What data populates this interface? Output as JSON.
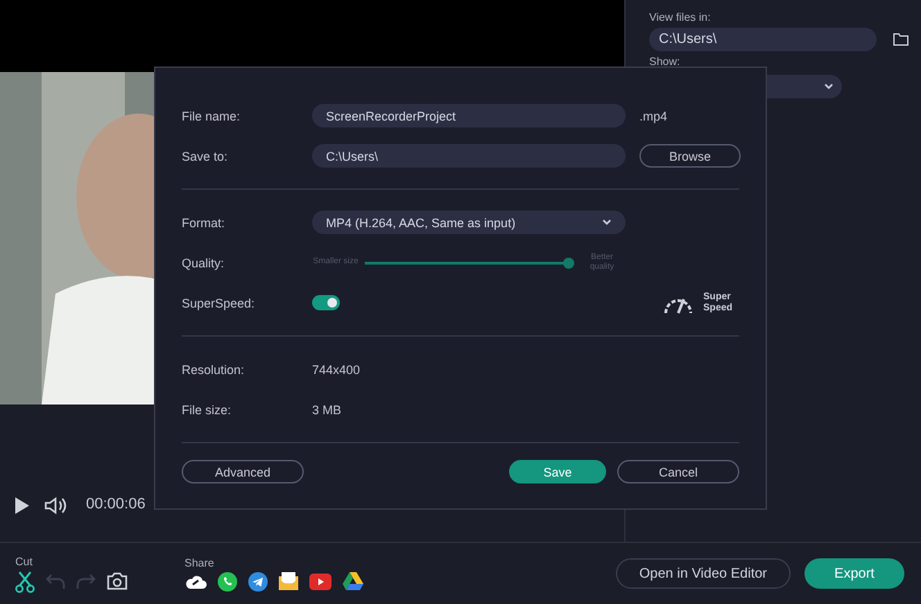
{
  "player": {
    "time": "00:00:06"
  },
  "right_panel": {
    "view_files_label": "View files in:",
    "view_files_path": "C:\\Users\\",
    "show_label": "Show:"
  },
  "dialog": {
    "file_name_label": "File name:",
    "file_name": "ScreenRecorderProject",
    "extension": ".mp4",
    "save_to_label": "Save to:",
    "save_to": "C:\\Users\\",
    "browse": "Browse",
    "format_label": "Format:",
    "format": "MP4 (H.264, AAC, Same as input)",
    "quality_label": "Quality:",
    "quality_min": "Smaller size",
    "quality_max": "Better quality",
    "quality": {
      "level": 0.98
    },
    "superspeed_label": "SuperSpeed:",
    "superspeed_on": true,
    "superspeed_badge": "Super Speed",
    "resolution_label": "Resolution:",
    "resolution": "744x400",
    "file_size_label": "File size:",
    "file_size": "3 MB",
    "advanced": "Advanced",
    "save": "Save",
    "cancel": "Cancel"
  },
  "bottom_bar": {
    "cut_label": "Cut",
    "undo_disabled": true,
    "redo_disabled": true,
    "share_label": "Share",
    "share_targets": [
      {
        "kind": "cloud"
      },
      {
        "kind": "whatsapp"
      },
      {
        "kind": "telegram"
      },
      {
        "kind": "mail"
      },
      {
        "kind": "youtube"
      },
      {
        "kind": "drive"
      }
    ],
    "open_editor": "Open in Video Editor",
    "export": "Export"
  }
}
